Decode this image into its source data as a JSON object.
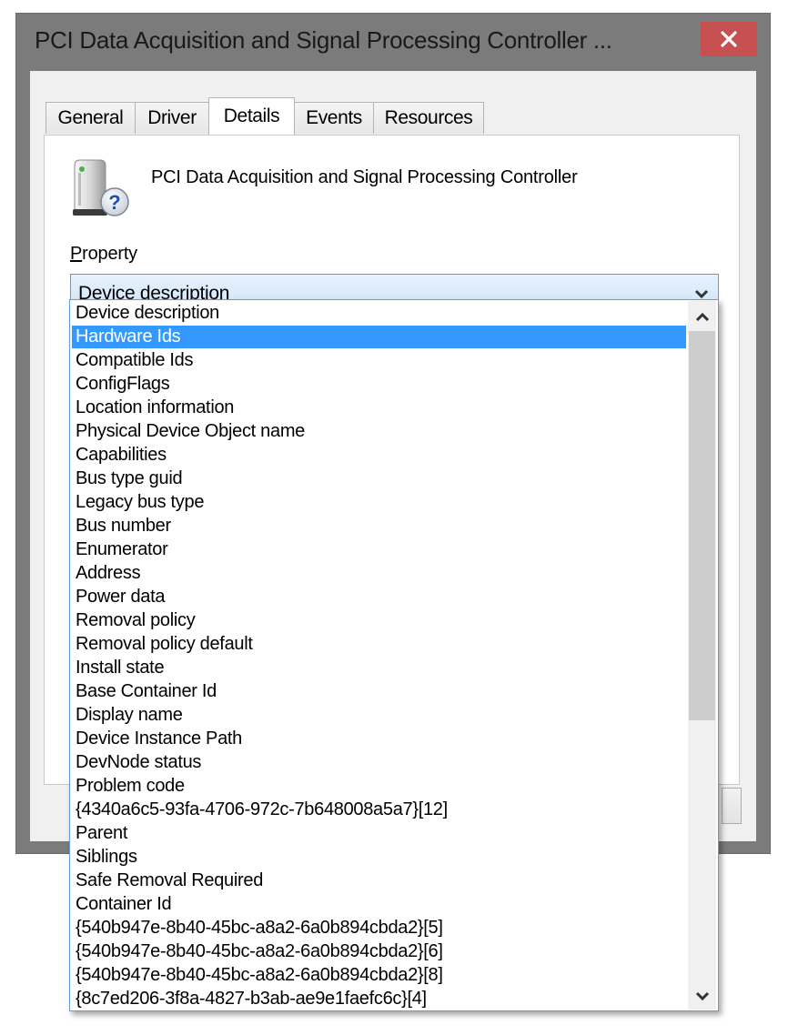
{
  "window": {
    "title": "PCI Data Acquisition and Signal Processing Controller ...",
    "close_label": "close"
  },
  "tabs": [
    {
      "label": "General",
      "active": false
    },
    {
      "label": "Driver",
      "active": false
    },
    {
      "label": "Details",
      "active": true
    },
    {
      "label": "Events",
      "active": false
    },
    {
      "label": "Resources",
      "active": false
    }
  ],
  "details": {
    "device_icon": "unknown-device-icon",
    "device_name": "PCI Data Acquisition and Signal Processing Controller",
    "property_label_accel": "P",
    "property_label_rest": "roperty",
    "property_selected": "Device description"
  },
  "dropdown": {
    "selected_index": 1,
    "scroll_thumb_fraction": 0.6,
    "items": [
      "Device description",
      "Hardware Ids",
      "Compatible Ids",
      "ConfigFlags",
      "Location information",
      "Physical Device Object name",
      "Capabilities",
      "Bus type guid",
      "Legacy bus type",
      "Bus number",
      "Enumerator",
      "Address",
      "Power data",
      "Removal policy",
      "Removal policy default",
      "Install state",
      "Base Container Id",
      "Display name",
      "Device Instance Path",
      "DevNode status",
      "Problem code",
      "{4340a6c5-93fa-4706-972c-7b648008a5a7}[12]",
      "Parent",
      "Siblings",
      "Safe Removal Required",
      "Container Id",
      "{540b947e-8b40-45bc-a8a2-6a0b894cbda2}[5]",
      "{540b947e-8b40-45bc-a8a2-6a0b894cbda2}[6]",
      "{540b947e-8b40-45bc-a8a2-6a0b894cbda2}[8]",
      "{8c7ed206-3f8a-4827-b3ab-ae9e1faefc6c}[4]"
    ]
  },
  "colors": {
    "selection": "#3399ff",
    "close_button": "#c75050",
    "frame": "#7b7b7b",
    "focus_border": "#569de5"
  }
}
